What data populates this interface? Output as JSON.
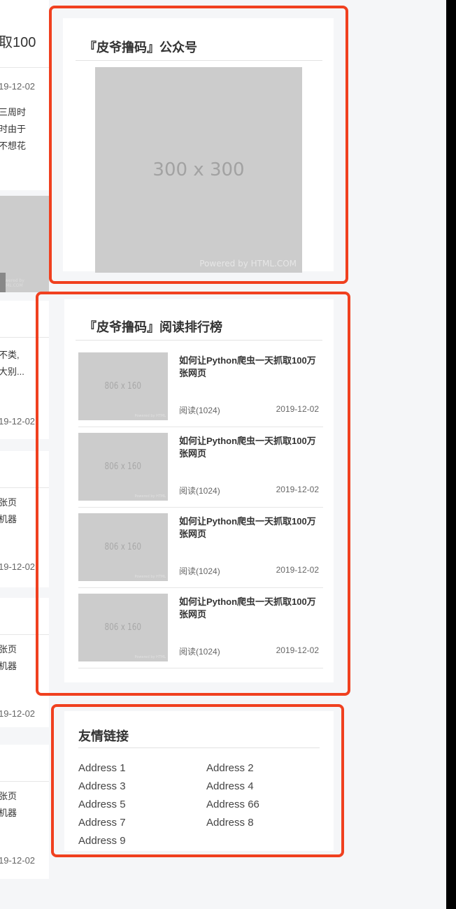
{
  "left_column": {
    "card1": {
      "title_fragment": "取100",
      "date": "19-12-02",
      "excerpt": "三周时\n时由于\n不想花"
    },
    "banner": {
      "watermark": "Powered by HTML.COM"
    },
    "card2": {
      "excerpt": "不类,\n大别...",
      "date": "19-12-02"
    },
    "card3": {
      "excerpt": "张页\n机器",
      "date": "19-12-02"
    },
    "card4": {
      "excerpt": "张页\n机器",
      "date": "19-12-02"
    },
    "card5": {
      "excerpt": "张页\n机器",
      "date": "19-12-02"
    }
  },
  "wechat": {
    "title": "『皮爷撸码』公众号",
    "qr_placeholder": "300 x 300",
    "powered": "Powered by HTML.COM"
  },
  "ranking": {
    "title": "『皮爷撸码』阅读排行榜",
    "thumb_size": "806 x 160",
    "thumb_watermark": "Powered by HTML",
    "items": [
      {
        "title": "如何让Python爬虫一天抓取100万张网页",
        "reads": "阅读(1024)",
        "date": "2019-12-02"
      },
      {
        "title": "如何让Python爬虫一天抓取100万张网页",
        "reads": "阅读(1024)",
        "date": "2019-12-02"
      },
      {
        "title": "如何让Python爬虫一天抓取100万张网页",
        "reads": "阅读(1024)",
        "date": "2019-12-02"
      },
      {
        "title": "如何让Python爬虫一天抓取100万张网页",
        "reads": "阅读(1024)",
        "date": "2019-12-02"
      }
    ]
  },
  "links": {
    "title": "友情链接",
    "items": [
      "Address 1",
      "Address 2",
      "Address 3",
      "Address 4",
      "Address 5",
      "Address 66",
      "Address 7",
      "Address 8",
      "Address 9"
    ]
  },
  "colors": {
    "highlight": "#f0401f",
    "placeholder": "#cccccc"
  }
}
